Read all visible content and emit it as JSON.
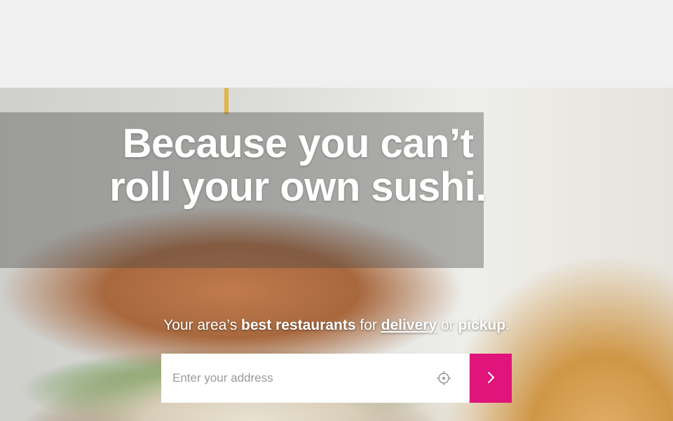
{
  "hero": {
    "headline": "Because you can’t roll your own sushi."
  },
  "tagline": {
    "prefix": "Your area’s ",
    "best": "best restaurants",
    "for": " for ",
    "delivery": "delivery",
    "or": " or ",
    "pickup": "pickup",
    "period": "."
  },
  "search": {
    "placeholder": "Enter your address",
    "locate_icon": "crosshair-icon",
    "submit_icon": "chevron-right-icon"
  },
  "colors": {
    "accent": "#e0147a",
    "topbar": "#f0f0f0"
  }
}
